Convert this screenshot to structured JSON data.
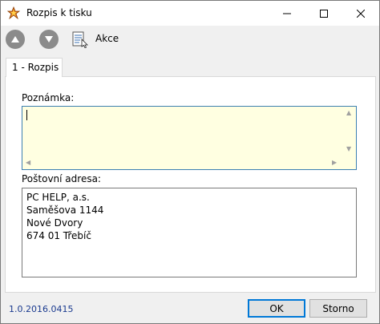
{
  "window": {
    "title": "Rozpis k tisku"
  },
  "toolbar": {
    "action_label": "Akce"
  },
  "tabs": [
    {
      "label": "1 - Rozpis"
    }
  ],
  "form": {
    "note_label": "Poznámka:",
    "note_value": "",
    "address_label": "Poštovní adresa:",
    "address_lines": [
      "PC HELP, a.s.",
      "Saměšova 1144",
      "Nové Dvory",
      "674 01 Třebíč"
    ]
  },
  "footer": {
    "version": "1.0.2016.0415",
    "ok_label": "OK",
    "cancel_label": "Storno"
  },
  "colors": {
    "note_background": "#ffffe1",
    "focus_border": "#3c7fb1",
    "version_text": "#1a3a8f"
  }
}
